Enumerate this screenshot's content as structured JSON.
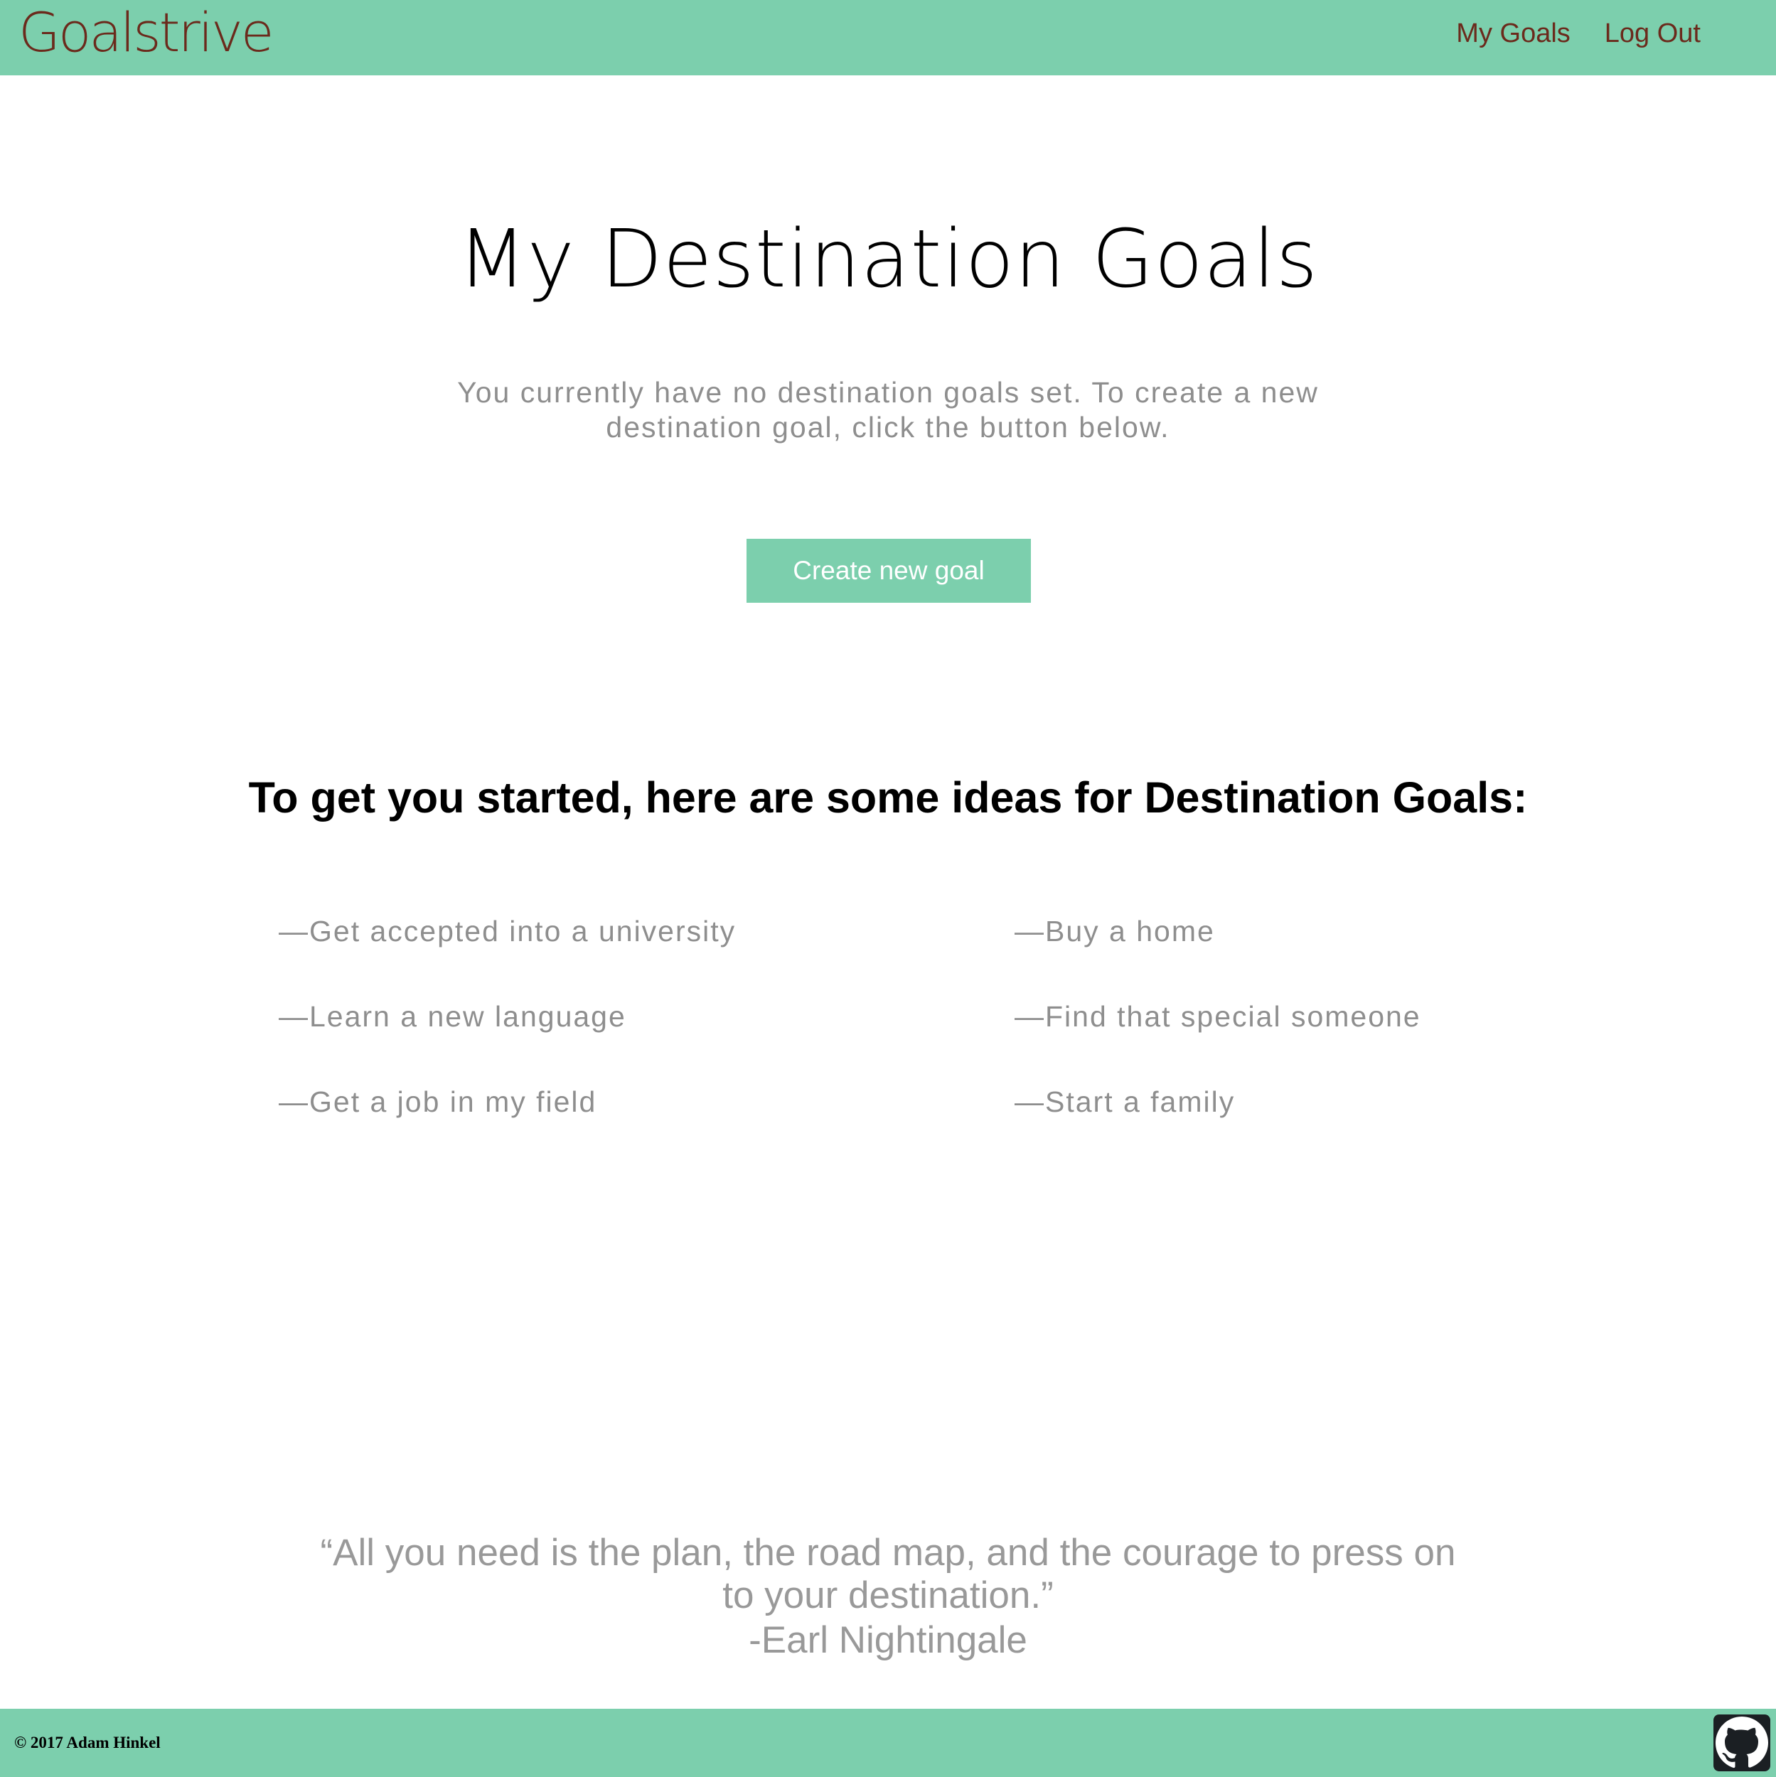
{
  "header": {
    "brand": "Goalstrive",
    "nav": [
      {
        "label": "My Goals"
      },
      {
        "label": "Log Out"
      }
    ]
  },
  "main": {
    "title": "My Destination Goals",
    "intro": "You currently have no destination goals set. To create a new destination goal, click the button below.",
    "create_button": "Create new goal",
    "ideas_heading": "To get you started, here are some ideas for Destination Goals:",
    "ideas": [
      "—Get accepted into a university",
      "—Buy a home",
      "—Learn a new language",
      "—Find that special someone",
      "—Get a job in my field",
      "—Start a family"
    ],
    "quote": "“All you need is the plan, the road map, and the courage to press on to your destination.”",
    "quote_author": "-Earl Nightingale"
  },
  "footer": {
    "copyright": "© 2017 Adam Hinkel",
    "github_icon": "github-icon"
  },
  "colors": {
    "brand_green": "#7ccfad",
    "brand_brown": "#6b2a1c",
    "muted_text": "#8e8e8e"
  }
}
